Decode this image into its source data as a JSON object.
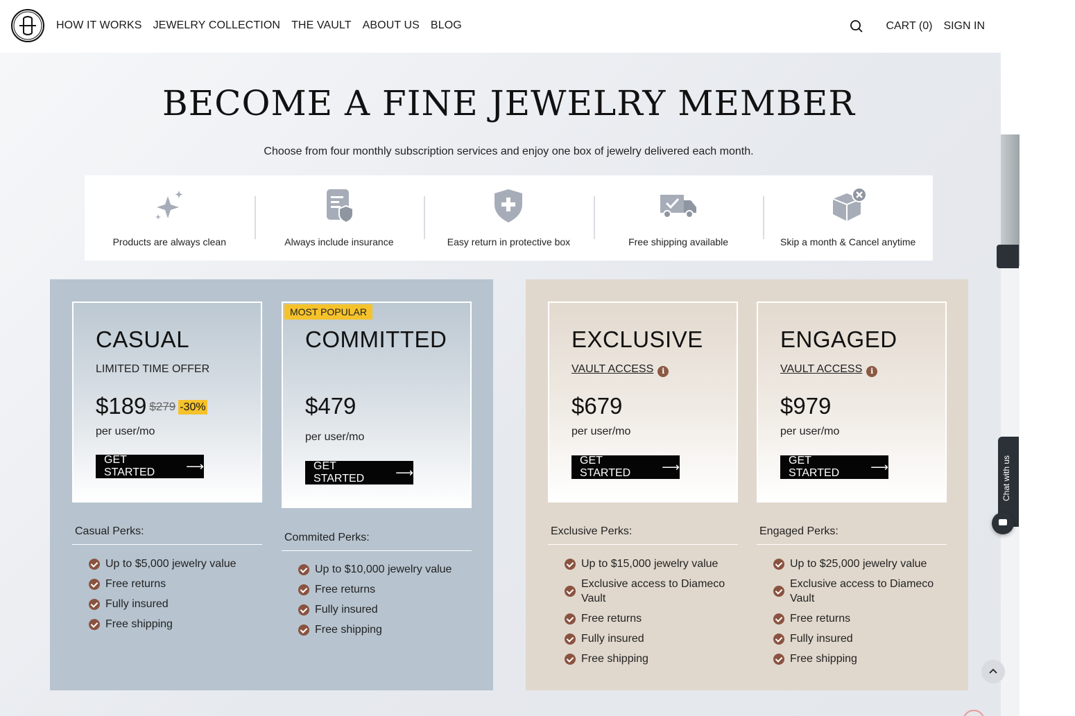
{
  "header": {
    "nav": [
      "HOW IT WORKS",
      "JEWELRY COLLECTION",
      "THE VAULT",
      "ABOUT US",
      "BLOG"
    ],
    "cart_label": "CART (0)",
    "signin_label": "SIGN IN",
    "search_icon": "search-icon"
  },
  "hero": {
    "title": "BECOME A FINE JEWELRY MEMBER",
    "subtitle": "Choose from four monthly subscription services and enjoy one box of jewelry delivered each month."
  },
  "features": [
    {
      "label": "Products are always clean",
      "icon": "sparkle-icon"
    },
    {
      "label": "Always include insurance",
      "icon": "document-shield-icon"
    },
    {
      "label": "Easy return in protective box",
      "icon": "shield-plus-icon"
    },
    {
      "label": "Free shipping available",
      "icon": "truck-icon"
    },
    {
      "label": "Skip a month & Cancel anytime",
      "icon": "box-cancel-icon"
    }
  ],
  "plans": {
    "casual": {
      "name": "CASUAL",
      "subtitle": "LIMITED TIME OFFER",
      "price": "$189",
      "old_price": "$279",
      "discount": "-30%",
      "per": "per user/mo",
      "cta": "GET STARTED",
      "perks_title": "Casual Perks:",
      "perks": [
        "Up to $5,000 jewelry value",
        "Free returns",
        "Fully insured",
        "Free shipping"
      ]
    },
    "committed": {
      "badge": "MOST POPULAR",
      "name": "COMMITTED",
      "price": "$479",
      "per": "per user/mo",
      "cta": "GET STARTED",
      "perks_title": "Commited Perks:",
      "perks": [
        "Up to $10,000 jewelry value",
        "Free returns",
        "Fully insured",
        "Free shipping"
      ]
    },
    "exclusive": {
      "name": "EXCLUSIVE",
      "vault": "VAULT ACCESS",
      "price": "$679",
      "per": "per user/mo",
      "cta": "GET STARTED",
      "perks_title": "Exclusive Perks:",
      "perks": [
        "Up to $15,000 jewelry value",
        "Exclusive access to Diameco Vault",
        "Free returns",
        "Fully insured",
        "Free shipping"
      ]
    },
    "engaged": {
      "name": "ENGAGED",
      "vault": "VAULT ACCESS",
      "price": "$979",
      "per": "per user/mo",
      "cta": "GET STARTED",
      "perks_title": "Engaged Perks:",
      "perks": [
        "Up to $25,000 jewelry value",
        "Exclusive access to Diameco Vault",
        "Free returns",
        "Fully insured",
        "Free shipping"
      ]
    }
  },
  "chat": {
    "label": "Chat with us"
  },
  "colors": {
    "blue_group": "#b7c4cf",
    "beige_group": "#e1d8cd",
    "badge": "#f5c22b",
    "check": "#8a5340"
  }
}
